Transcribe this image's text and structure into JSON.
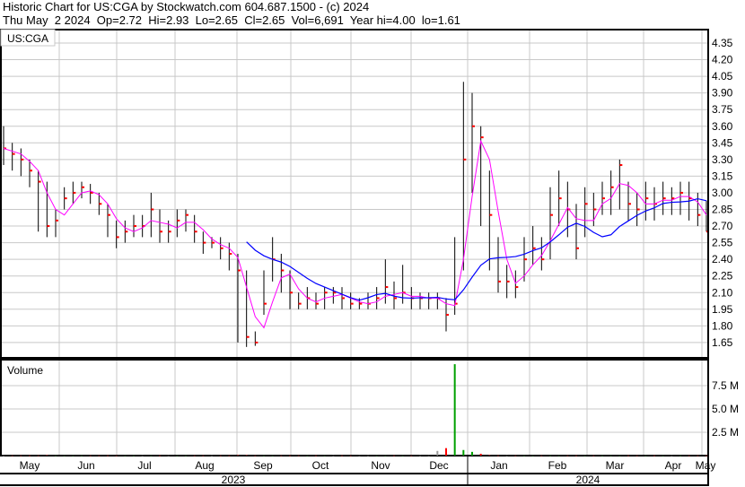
{
  "header": {
    "title": "Historic Chart for US:CGA by Stockwatch.com 604.687.1500 - (c) 2024",
    "quote": "Thu May  2 2024  Op=2.72  Hi=2.93  Lo=2.65  Cl=2.65  Vol=6,691  Year hi=4.00  lo=1.61"
  },
  "chart_data": {
    "type": "line",
    "title": "US:CGA",
    "price_axis": {
      "ticks": [
        "4.35",
        "4.20",
        "4.05",
        "3.90",
        "3.75",
        "3.60",
        "3.45",
        "3.30",
        "3.15",
        "3.00",
        "2.85",
        "2.70",
        "2.55",
        "2.40",
        "2.25",
        "2.10",
        "1.95",
        "1.80",
        "1.65"
      ],
      "ylim": [
        1.65,
        4.35
      ]
    },
    "volume_panel": {
      "label": "Volume",
      "ticks": [
        "7.5 M",
        "5.0 M",
        "2.5 M"
      ],
      "ylim": [
        0,
        10
      ]
    },
    "months": [
      "May",
      "Jun",
      "Jul",
      "Aug",
      "Sep",
      "Oct",
      "Nov",
      "Dec",
      "Jan",
      "Feb",
      "Mar",
      "Apr",
      "May"
    ],
    "years": [
      "2023",
      "2024"
    ],
    "grid": true,
    "series": [
      {
        "name": "close",
        "values": [
          3.4,
          3.35,
          3.3,
          3.2,
          3.1,
          2.7,
          2.75,
          2.95,
          3.0,
          3.05,
          3.0,
          2.9,
          2.8,
          2.6,
          2.65,
          2.7,
          2.7,
          2.85,
          2.65,
          2.65,
          2.75,
          2.8,
          2.65,
          2.55,
          2.55,
          2.5,
          2.45,
          2.3,
          1.7,
          1.65,
          2.0,
          2.4,
          2.3,
          2.1,
          2.0,
          2.05,
          2.0,
          2.1,
          2.1,
          2.05,
          2.0,
          2.0,
          2.0,
          2.05,
          2.15,
          2.05,
          2.1,
          2.05,
          2.05,
          2.05,
          2.05,
          1.9,
          2.0,
          3.3,
          3.6,
          3.5,
          2.8,
          2.2,
          2.2,
          2.15,
          2.4,
          2.5,
          2.4,
          2.8,
          2.95,
          2.85,
          2.5,
          2.9,
          2.85,
          2.95,
          3.05,
          3.25,
          2.9,
          2.85,
          2.95,
          2.9,
          2.95,
          2.95,
          3.0,
          2.95,
          2.8,
          2.65
        ]
      },
      {
        "name": "high",
        "values": [
          3.6,
          3.45,
          3.4,
          3.3,
          3.2,
          3.1,
          2.85,
          3.05,
          3.1,
          3.1,
          3.08,
          3.0,
          2.9,
          2.75,
          2.75,
          2.8,
          2.8,
          3.0,
          2.85,
          2.75,
          2.85,
          2.85,
          2.8,
          2.65,
          2.6,
          2.6,
          2.55,
          2.45,
          2.3,
          1.75,
          2.3,
          2.6,
          2.45,
          2.3,
          2.1,
          2.15,
          2.1,
          2.15,
          2.15,
          2.15,
          2.1,
          2.05,
          2.1,
          2.15,
          2.4,
          2.2,
          2.35,
          2.15,
          2.1,
          2.1,
          2.1,
          2.05,
          2.6,
          4.0,
          3.9,
          3.6,
          3.2,
          2.6,
          2.35,
          2.3,
          2.6,
          2.7,
          2.6,
          3.05,
          3.2,
          3.1,
          2.9,
          3.05,
          3.0,
          3.1,
          3.2,
          3.3,
          3.1,
          3.0,
          3.1,
          3.05,
          3.1,
          3.05,
          3.1,
          3.1,
          3.0,
          2.93
        ]
      },
      {
        "name": "low",
        "values": [
          3.25,
          3.2,
          3.15,
          3.05,
          2.65,
          2.6,
          2.6,
          2.85,
          2.9,
          2.95,
          2.9,
          2.8,
          2.6,
          2.5,
          2.55,
          2.6,
          2.6,
          2.6,
          2.55,
          2.55,
          2.6,
          2.65,
          2.55,
          2.45,
          2.5,
          2.4,
          2.3,
          1.65,
          1.61,
          1.62,
          1.9,
          2.2,
          2.1,
          1.95,
          1.95,
          1.95,
          1.95,
          1.95,
          2.0,
          1.95,
          1.95,
          1.95,
          1.95,
          1.95,
          2.0,
          1.95,
          2.0,
          1.95,
          1.95,
          1.95,
          1.95,
          1.75,
          1.9,
          2.3,
          3.0,
          2.7,
          2.3,
          2.1,
          2.05,
          2.05,
          2.2,
          2.35,
          2.3,
          2.4,
          2.7,
          2.6,
          2.4,
          2.6,
          2.7,
          2.8,
          2.8,
          2.85,
          2.75,
          2.7,
          2.75,
          2.75,
          2.8,
          2.8,
          2.8,
          2.75,
          2.7,
          2.65
        ]
      },
      {
        "name": "volume_millions",
        "values": [
          0.02,
          0.02,
          0.02,
          0.02,
          0.02,
          0.05,
          0.02,
          0.02,
          0.02,
          0.02,
          0.02,
          0.02,
          0.02,
          0.02,
          0.02,
          0.02,
          0.02,
          0.02,
          0.02,
          0.02,
          0.02,
          0.02,
          0.02,
          0.02,
          0.02,
          0.02,
          0.02,
          0.05,
          0.05,
          0.02,
          0.02,
          0.02,
          0.02,
          0.02,
          0.02,
          0.02,
          0.02,
          0.02,
          0.02,
          0.02,
          0.02,
          0.02,
          0.02,
          0.02,
          0.02,
          0.02,
          0.02,
          0.02,
          0.02,
          0.02,
          0.5,
          0.8,
          9.8,
          0.6,
          0.4,
          0.2,
          0.05,
          0.02,
          0.02,
          0.02,
          0.02,
          0.02,
          0.02,
          0.02,
          0.02,
          0.02,
          0.02,
          0.02,
          0.02,
          0.02,
          0.02,
          0.02,
          0.02,
          0.02,
          0.02,
          0.02,
          0.02,
          0.02,
          0.02,
          0.02,
          0.02,
          0.02
        ]
      }
    ]
  },
  "colors": {
    "bar": "#000000",
    "close_tick": "#ff0000",
    "ma_short": "#ff00ff",
    "ma_long": "#0000ff",
    "vol_up": "#00a000",
    "vol_down": "#ff0000",
    "vol_flat": "#999999",
    "grid": "#c8c8c8"
  }
}
